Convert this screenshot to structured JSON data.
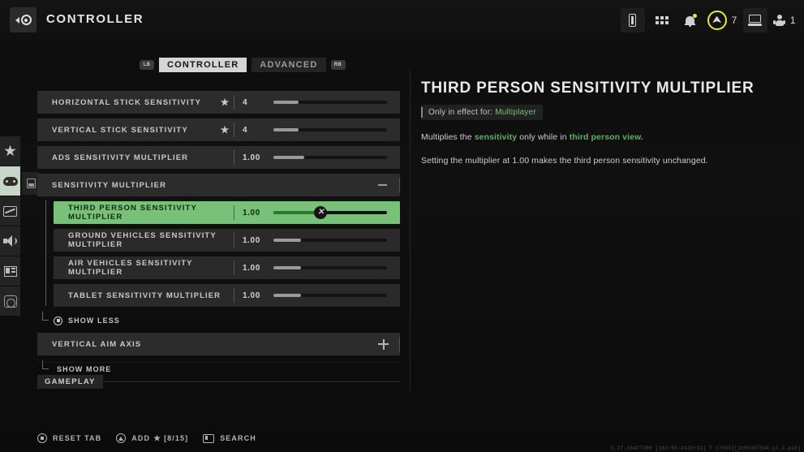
{
  "header": {
    "title": "CONTROLLER",
    "back_icon": "back-arrow-icon",
    "icons": {
      "battery": "battery-icon",
      "grid": "apps-grid-icon",
      "bell": "notifications-bell-icon",
      "rank": "rank-emblem-icon",
      "card": "player-card-icon",
      "party": "party-members-icon"
    },
    "rank_count": "7",
    "party_count": "1"
  },
  "rail": {
    "items": [
      {
        "icon": "star-icon",
        "name": "favorites",
        "active": false
      },
      {
        "icon": "gamepad-icon",
        "name": "controller",
        "active": true
      },
      {
        "icon": "monitor-icon",
        "name": "graphics",
        "active": false
      },
      {
        "icon": "speaker-icon",
        "name": "audio",
        "active": false
      },
      {
        "icon": "interface-icon",
        "name": "interface",
        "active": false
      },
      {
        "icon": "accessibility-icon",
        "name": "accessibility",
        "active": false
      }
    ],
    "scroll_icon": "scroll-indicator-icon"
  },
  "tabs": {
    "left_bumper": "LB",
    "right_bumper": "RB",
    "items": [
      {
        "label": "CONTROLLER",
        "active": true
      },
      {
        "label": "ADVANCED",
        "active": false
      }
    ]
  },
  "settings": {
    "rows": [
      {
        "label": "HORIZONTAL STICK SENSITIVITY",
        "starred": true,
        "value": "4",
        "fill": 22,
        "type": "slider"
      },
      {
        "label": "VERTICAL STICK SENSITIVITY",
        "starred": true,
        "value": "4",
        "fill": 22,
        "type": "slider"
      },
      {
        "label": "ADS SENSITIVITY MULTIPLIER",
        "starred": false,
        "value": "1.00",
        "fill": 27,
        "type": "slider"
      },
      {
        "label": "SENSITIVITY MULTIPLIER",
        "starred": false,
        "value": "",
        "fill": 0,
        "type": "group-expanded"
      }
    ],
    "sub_rows": [
      {
        "label": "THIRD PERSON SENSITIVITY MULTIPLIER",
        "value": "1.00",
        "fill": 44,
        "selected": true
      },
      {
        "label": "GROUND VEHICLES SENSITIVITY MULTIPLIER",
        "value": "1.00",
        "fill": 24,
        "selected": false
      },
      {
        "label": "AIR VEHICLES SENSITIVITY MULTIPLIER",
        "value": "1.00",
        "fill": 24,
        "selected": false
      },
      {
        "label": "TABLET SENSITIVITY MULTIPLIER",
        "value": "1.00",
        "fill": 24,
        "selected": false
      }
    ],
    "show_less": "SHOW LESS",
    "vertical_aim_axis": {
      "label": "VERTICAL AIM AXIS",
      "value": "",
      "type": "group-collapsed"
    },
    "show_more": "SHOW MORE",
    "section": "GAMEPLAY",
    "slider_knob_glyph": "✕"
  },
  "detail": {
    "title": "THIRD PERSON SENSITIVITY MULTIPLIER",
    "effect_label": "Only in effect for:",
    "effect_value": "Multiplayer",
    "paragraph1_a": "Multiplies the ",
    "paragraph1_b": "sensitivity",
    "paragraph1_c": " only while in ",
    "paragraph1_d": "third person view.",
    "paragraph2": "Setting the multiplier at 1.00 makes the third person sensitivity unchanged."
  },
  "bottombar": {
    "reset_tab": "RESET TAB",
    "add": "ADD",
    "add_count": "[8/15]",
    "search": "SEARCH",
    "debug": "9.27.16427308 [163:58:2433+11] T [7000][1699387534.pl.G.ps5]"
  },
  "colors": {
    "accent_green": "#79c078",
    "text_green": "#5faf5f",
    "rank_yellow": "#e8e83a"
  }
}
